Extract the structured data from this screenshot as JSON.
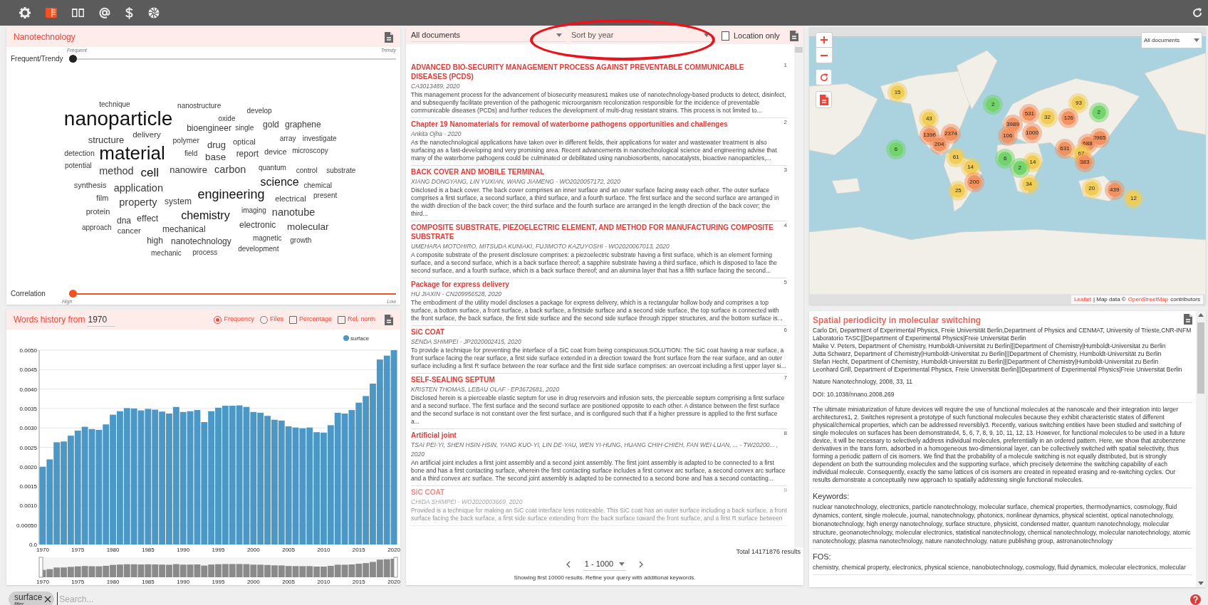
{
  "toolbar": [
    {
      "selected": false
    },
    {
      "selected": true
    },
    {
      "selected": false
    },
    {
      "selected": false
    },
    {
      "selected": false
    },
    {
      "selected": false
    }
  ],
  "word_cloud": {
    "title": "Nanotechnology",
    "sliders": [
      {
        "kind": "top_labels",
        "label": "Frequent/Trendy",
        "min_label": "Frequent",
        "max_label": "Trendy",
        "level": 0
      },
      {
        "kind": "bottom_labels",
        "label": "Correlation",
        "min_label": "High",
        "max_label": "Low",
        "level": 0
      }
    ],
    "words": [
      "technique",
      "nanostructure",
      "develop",
      "nanoparticle",
      "oxide",
      "bioengineer",
      "single",
      "gold",
      "graphene",
      "structure",
      "delivery",
      "polymer",
      "drug",
      "optical",
      "array",
      "investigate",
      "detection",
      "material",
      "field",
      "base",
      "report",
      "device",
      "microscopy",
      "potential",
      "method",
      "cell",
      "nanowire",
      "carbon",
      "quantum",
      "control",
      "substrate",
      "synthesis",
      "application",
      "science",
      "chemical",
      "film",
      "property",
      "system",
      "engineering",
      "electrical",
      "present",
      "protein",
      "dna",
      "effect",
      "chemistry",
      "imaging",
      "nanotube",
      "approach",
      "cancer",
      "mechanical",
      "electronic",
      "molecular",
      "high",
      "nanotechnology",
      "magnetic",
      "growth",
      "mechanic",
      "process",
      "development"
    ]
  },
  "history": {
    "title": "Words history from",
    "year": "1970",
    "options": [
      {
        "kind": "radio",
        "label": "Frequency",
        "checked": true
      },
      {
        "kind": "radio",
        "label": "Files",
        "checked": false
      },
      {
        "kind": "checkbox",
        "label": "Percentage",
        "checked": false
      },
      {
        "kind": "checkbox",
        "label": "Rel. norm",
        "checked": false
      }
    ],
    "chart_data": {
      "type": "bar",
      "grid": true,
      "x": [
        1970,
        1971,
        1972,
        1973,
        1974,
        1975,
        1976,
        1977,
        1978,
        1979,
        1980,
        1981,
        1982,
        1983,
        1984,
        1985,
        1986,
        1987,
        1988,
        1989,
        1990,
        1991,
        1992,
        1993,
        1994,
        1995,
        1996,
        1997,
        1998,
        1999,
        2000,
        2001,
        2002,
        2003,
        2004,
        2005,
        2006,
        2007,
        2008,
        2009,
        2010,
        2011,
        2012,
        2013,
        2014,
        2015,
        2016,
        2017,
        2018,
        2019,
        2020
      ],
      "series": [
        {
          "name": "surface",
          "color": "#4b97c6",
          "values": [
            0.002,
            0.00219,
            0.00263,
            0.00265,
            0.0028,
            0.00293,
            0.00303,
            0.00297,
            0.00295,
            0.00309,
            0.00334,
            0.00343,
            0.00351,
            0.0035,
            0.00345,
            0.00349,
            0.00347,
            0.00342,
            0.00337,
            0.00354,
            0.00341,
            0.00343,
            0.00346,
            0.00315,
            0.00343,
            0.00352,
            0.00357,
            0.00357,
            0.00358,
            0.00354,
            0.00341,
            0.00339,
            0.00331,
            0.00321,
            0.00319,
            0.00304,
            0.00301,
            0.00299,
            0.00301,
            0.00289,
            0.00288,
            0.00307,
            0.00339,
            0.00337,
            0.00346,
            0.00365,
            0.00382,
            0.00414,
            0.00476,
            0.00486,
            0.005
          ]
        }
      ],
      "xlim": [
        1969.5,
        2020.5
      ],
      "ylim": [
        0,
        0.005
      ],
      "yticks": [
        {
          "value": 0,
          "label": "0.0"
        },
        {
          "value": 0.0005,
          "label": "0.00050"
        },
        {
          "value": 0.001,
          "label": "0.0010"
        },
        {
          "value": 0.0015,
          "label": "0.0015"
        },
        {
          "value": 0.002,
          "label": "0.0020"
        },
        {
          "value": 0.0025,
          "label": "0.0025"
        },
        {
          "value": 0.003,
          "label": "0.0030"
        },
        {
          "value": 0.0035,
          "label": "0.0035"
        },
        {
          "value": 0.004,
          "label": "0.0040"
        },
        {
          "value": 0.0045,
          "label": "0.0045"
        },
        {
          "value": 0.005,
          "label": "0.0050"
        }
      ],
      "xticks": [
        {
          "value": 1970,
          "label": "1970"
        },
        {
          "value": 1975,
          "label": "1975"
        },
        {
          "value": 1980,
          "label": "1980"
        },
        {
          "value": 1985,
          "label": "1985"
        },
        {
          "value": 1990,
          "label": "1990"
        },
        {
          "value": 1995,
          "label": "1995"
        },
        {
          "value": 2000,
          "label": "2000"
        },
        {
          "value": 2005,
          "label": "2005"
        },
        {
          "value": 2010,
          "label": "2010"
        },
        {
          "value": 2015,
          "label": "2015"
        },
        {
          "value": 2020,
          "label": "2020"
        }
      ]
    },
    "overview_ticks": [
      "1970",
      "1975",
      "1980",
      "1985",
      "1990",
      "1995",
      "2000",
      "2005",
      "2010",
      "2015",
      "2020"
    ]
  },
  "results": {
    "scope": "All documents",
    "sort": "Sort by year",
    "location_only": {
      "label": "Location only",
      "checked": false
    },
    "items": [
      {
        "number": "1",
        "title": "ADVANCED BIO-SECURITY MANAGEMENT PROCESS AGAINST PREVENTABLE COMMUNICABLE DISEASES (PCDS)",
        "meta": "CA3013489, 2020",
        "abstract": "This management process for the advancement of biosecurity measures1 makes use of nanotechnology-based products to detect, disinfect, and subsequently facilitate prevention of the pathogenic microorganism recolonization responsible for the incidence of preventable communicable diseases (PCDs) and further reduces the development of multi-drug resistant strains. This process is not limited to...",
        "faded": false
      },
      {
        "number": "2",
        "title": "Chapter 19 Nanomaterials for removal of waterborne pathogens opportunities and challenges",
        "meta": "Ankita Ojha - 2020",
        "abstract": "As the nanotechnological applications have taken over in different fields, their applications for water and wastewater treatment is also surfacing as a fast-developing and very promising area. Recent advancements in nanotechnological science and engineering advise that many of the waterborne pathogens could be culminated or debilitated using nanobiosorbents, nanocatalysts, bioactive nanoparticles,...",
        "faded": false
      },
      {
        "number": "3",
        "title": "BACK COVER AND MOBILE TERMINAL",
        "meta": "XIANG DONGYANG, LIN YUXIAN, WANG JIAMENG - WO2020057172, 2020",
        "abstract": "Disclosed is a back cover. The back cover comprises an inner surface and an outer surface facing away each other. The outer surface comprises a first surface, a second surface, a third surface, and a fourth surface. The first surface and the second surface are arranged in the width direction of the back cover; the third surface and the fourth surface are arranged in the length direction of the back cover; the third...",
        "faded": false
      },
      {
        "number": "4",
        "title": "COMPOSITE SUBSTRATE, PIEZOELECTRIC ELEMENT, AND METHOD FOR MANUFACTURING COMPOSITE SUBSTRATE",
        "meta": "UMEHARA MOTOHIRO, MITSUDA KUNIAKI, FUJIMOTO KAZUYOSHI - WO2020067013, 2020",
        "abstract": "A composite substrate of the present disclosure comprises: a piezoelectric substrate having a first surface, which is an element forming surface, and a second surface, which is a back surface thereof; a sapphire substrate having a third surface, which is disposed to face the second surface, and a fourth surface, which is a back surface thereof; and an alumina layer that has a fifth surface facing the second...",
        "faded": false
      },
      {
        "number": "5",
        "title": "Package for express delivery",
        "meta": "HU JIAXIN - CN209956528, 2020",
        "abstract": "The embodiment of the utility model discloses a package for express delivery, which is a rectangular hollow body and comprises a top surface, a bottom surface, a front surface, a back surface, a firstside surface and a second side surface, the top surface is connected with the front surface, the back surface, the first side surface and the second side surface through zipper structures, and the bottom surface is...",
        "faded": false
      },
      {
        "number": "6",
        "title": "SiC COAT",
        "meta": "SENDA SHIMPEI - JP2020002415, 2020",
        "abstract": "To provide a technique for preventing the interface of a SiC coat from being conspicuous.SOLUTION: The SiC coat having a rear surface, a front surface facing the rear surface, a first side surface extended in a direction toward the front surface from the rear surface, and an outer surface including a first R surface between the rear surface and the first side surface comprises: an overcoat including a first upper layer si...",
        "faded": false
      },
      {
        "number": "7",
        "title": "SELF-SEALING SEPTUM",
        "meta": "KRISTEN THOMAS, LEBAU OLAF - EP3672681, 2020",
        "abstract": "Disclosed herein is a pierceable elastic septum for use in drug reservoirs and infusion sets, the pierceable septum comprising a first surface and a second surface. The first surface and the second surface are positioned opposite to each other. A distance between the first surface and the second surface is not constant over the first surface, and is configured such that if a higher pressure is applied to the first surface a...",
        "faded": false
      },
      {
        "number": "8",
        "title": "Artificial joint",
        "meta": "TSAI PEI-YI, SHEN HSIN-HSIN, YANG KUO-YI, LIN DE-YAU, WEN YI-HUNG, HUANG CHIH-CHIEH, FAN WEI-LUAN, ...  - TW20200... , 2020",
        "abstract": "An artificial joint includes a first joint assembly and a second joint assembly. The first joint assembly is adapted to be connected to a first bone and has a first contacting surface, wherein the first contacting surface includes a first convex arc surface, a second convex arc surface and a third convex arc surface. The second joint assembly is adapted to be connected to a second bone and has a second contacting...",
        "faded": false
      },
      {
        "number": "9",
        "title": "SiC COAT",
        "meta": "CHIDA SHIMPEI - WO2020003669, 2020",
        "abstract": "Provided is a technique for making an SiC coat interface less noticeable. This SiC coat has an outer surface including a back surface, a front surface facing the back surface, a first side surface extending from the back surface toward the front surface, and a first R surface between",
        "faded": true
      }
    ],
    "total": "Total 14171876 results",
    "range": "1 - 1000",
    "note": "Showing first 10000 results. Refine your query with additional keywords."
  },
  "map": {
    "dropdown": "All documents",
    "clusters": [
      {
        "count": "15",
        "color": "#f2cd55"
      },
      {
        "count": "2",
        "color": "#72d46a"
      },
      {
        "count": "43",
        "color": "#f2cd55"
      },
      {
        "count": "93",
        "color": "#f2cd55"
      },
      {
        "count": "2",
        "color": "#72d46a"
      },
      {
        "count": "126",
        "color": "#f29261"
      },
      {
        "count": "3989",
        "color": "#f29261"
      },
      {
        "count": "32",
        "color": "#f2cd55"
      },
      {
        "count": "531",
        "color": "#f29261"
      },
      {
        "count": "1396",
        "color": "#f29261"
      },
      {
        "count": "2374",
        "color": "#f29261"
      },
      {
        "count": "106",
        "color": "#f29261"
      },
      {
        "count": "1000",
        "color": "#f29261"
      },
      {
        "count": "3965",
        "color": "#f29261"
      },
      {
        "count": "688",
        "color": "#f29261"
      },
      {
        "count": "204",
        "color": "#f29261"
      },
      {
        "count": "631",
        "color": "#f29261"
      },
      {
        "count": "6",
        "color": "#72d46a"
      },
      {
        "count": "67",
        "color": "#f2cd55"
      },
      {
        "count": "61",
        "color": "#f2cd55"
      },
      {
        "count": "6",
        "color": "#72d46a"
      },
      {
        "count": "14",
        "color": "#f2cd55"
      },
      {
        "count": "383",
        "color": "#f29261"
      },
      {
        "count": "14",
        "color": "#f2cd55"
      },
      {
        "count": "2",
        "color": "#72d46a"
      },
      {
        "count": "200",
        "color": "#f29261"
      },
      {
        "count": "34",
        "color": "#f2cd55"
      },
      {
        "count": "25",
        "color": "#f2cd55"
      },
      {
        "count": "20",
        "color": "#f2cd55"
      },
      {
        "count": "439",
        "color": "#f29261"
      },
      {
        "count": "12",
        "color": "#f2cd55"
      }
    ],
    "attribution": {
      "link": "Leaflet",
      "text": "| Map data ©",
      "source": "OpenStreetMap",
      "suffix": "contributors"
    }
  },
  "detail": {
    "title": "Spatial periodicity in molecular switching",
    "authors": [
      "Carlo Dri, Department of Experimental Physics, Freie Universität Berlin,Department of Physics and CENMAT, University of Trieste,CNR-INFM Laboratorio TASC|||Department of Experimental Physics|Freie Universitat Berlin",
      "Maike V. Peters, Department of Chemistry, Humboldt-Universität zu Berlin|||Department of Chemistry|Humboldt-Universitat zu Berlin",
      "Jutta Schwarz, Department of Chemistry|Humboldt-Universitat zu Berlin|||Department of Chemistry, Humboldt-Universität zu Berlin",
      "Stefan Hecht, Department of Chemistry, Humboldt-Universität zu Berlin|||Department of Chemistry|Humboldt-Universitat zu Berlin",
      "Leonhard Grill, Department of Experimental Physics, Freie Universität Berlin|||Department of Experimental Physics|Freie Universitat Berlin"
    ],
    "journal": "Nature Nanotechnology, 2008, 33, 11",
    "doi": "DOI: 10.1038/nnano.2008.269",
    "abstract": "The ultimate miniaturization of future devices will require the use of functional molecules at the nanoscale and their integration into larger architectures1, 2. Switches represent a prototype of such functional molecules because they exhibit characteristic states of different physical/chemical properties, which can be addressed reversibly3. Recently, various switching entities have been studied and switching of single molecules on surfaces has been demonstrated4, 5, 6, 7, 8, 9, 10, 11, 12, 13. However, for functional molecules to be used in a future device, it will be necessary to selectively address individual molecules, preferentially in an ordered pattern. Here, we show that azobenzene derivatives in the trans form, adsorbed in a homogeneous two-dimensional layer, can be collectively switched with spatial selectivity, thus forming a periodic pattern of cis isomers. We find that the probability of a molecule switching is not equally distributed, but is strongly dependent on both the surrounding molecules and the supporting surface, which precisely determine the switching capability of each individual molecule. Consequently, exactly the same lattices of cis isomers are created in repeated erasing and re-switching cycles. Our results demonstrate a conceptually new approach to spatially addressing single functional molecules.",
    "sections": [
      {
        "heading": "Keywords:",
        "text": "nuclear nanotechnology, electronics, particle nanotechnology, molecular surface, chemical properties, thermodynamics, cosmology, fluid dynamics, content, single molecule, journal, nanotechnology, photonics, nonlinear dynamics, physical scientist, optical nanotechnology, bionanotechnology, high energy nanotechnology, surface structure, physicist, condensed matter, quantum nanotechnology, molecular structure, geonanotechnology, molecular electronics, statistical nanotechnology, chemical nanotechnology, molecular nanotechnology, atomic nanotechnology, plasma nanotechnology, nature nanotechnology, nature publishing group, astronanotechnology"
      },
      {
        "heading": "FOS:",
        "text": "chemistry, chemical property, electronics, physical science, nanobiotechnology, cosmology, fluid dynamics, molecular electronics, molecular"
      }
    ]
  },
  "filter_bar": {
    "chips": [
      {
        "label": "surface",
        "sublabel": "filter"
      }
    ],
    "placeholder": "Search..."
  }
}
